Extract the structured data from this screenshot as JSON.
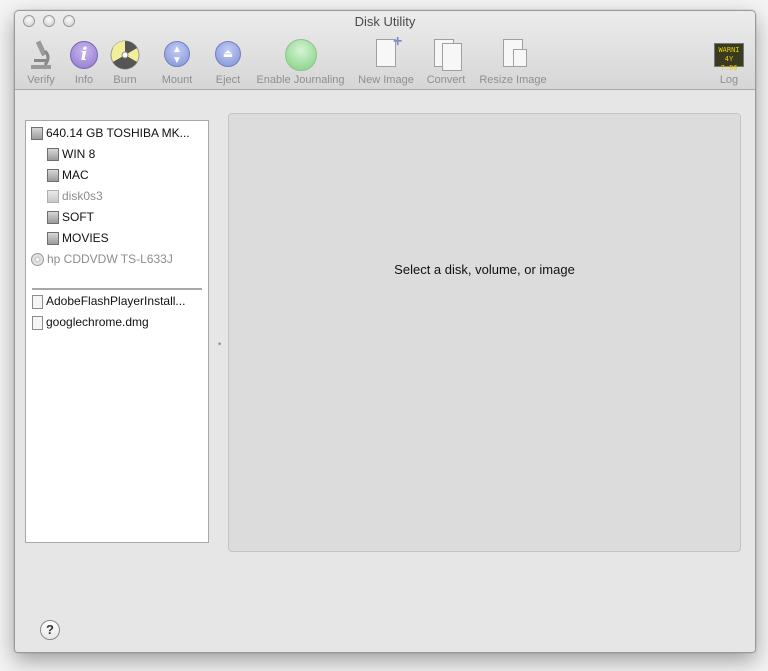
{
  "window": {
    "title": "Disk Utility"
  },
  "toolbar": {
    "items": [
      {
        "label": "Verify",
        "icon": "microscope-icon"
      },
      {
        "label": "Info",
        "icon": "info-icon"
      },
      {
        "label": "Burn",
        "icon": "burn-icon"
      },
      {
        "label": "Mount",
        "icon": "mount-icon"
      },
      {
        "label": "Eject",
        "icon": "eject-icon"
      },
      {
        "label": "Enable Journaling",
        "icon": "journal-icon"
      },
      {
        "label": "New Image",
        "icon": "new-image-icon"
      },
      {
        "label": "Convert",
        "icon": "convert-icon"
      },
      {
        "label": "Resize Image",
        "icon": "resize-image-icon"
      },
      {
        "label": "Log",
        "icon": "log-icon"
      }
    ],
    "log_display": [
      "WARNI",
      "4Y 7:86"
    ]
  },
  "sidebar": {
    "disks": [
      {
        "label": "640.14 GB TOSHIBA MK...",
        "icon": "hard-disk-icon"
      },
      {
        "label": "WIN 8",
        "icon": "volume-icon"
      },
      {
        "label": "MAC",
        "icon": "volume-icon"
      },
      {
        "label": "disk0s3",
        "icon": "volume-icon"
      },
      {
        "label": "SOFT",
        "icon": "volume-icon"
      },
      {
        "label": "MOVIES",
        "icon": "volume-icon"
      },
      {
        "label": "hp CDDVDW TS-L633J",
        "icon": "optical-drive-icon"
      }
    ],
    "images": [
      {
        "label": "AdobeFlashPlayerInstall...",
        "icon": "disk-image-icon"
      },
      {
        "label": "googlechrome.dmg",
        "icon": "disk-image-icon"
      }
    ]
  },
  "detail": {
    "message": "Select a disk, volume, or image"
  },
  "help": {
    "label": "?"
  },
  "colors": {
    "info": "#a08ad6",
    "mount": "#8ea0e0",
    "journal": "#8ed48e",
    "log_bg": "#3a3a22",
    "log_text": "#e8d000"
  }
}
